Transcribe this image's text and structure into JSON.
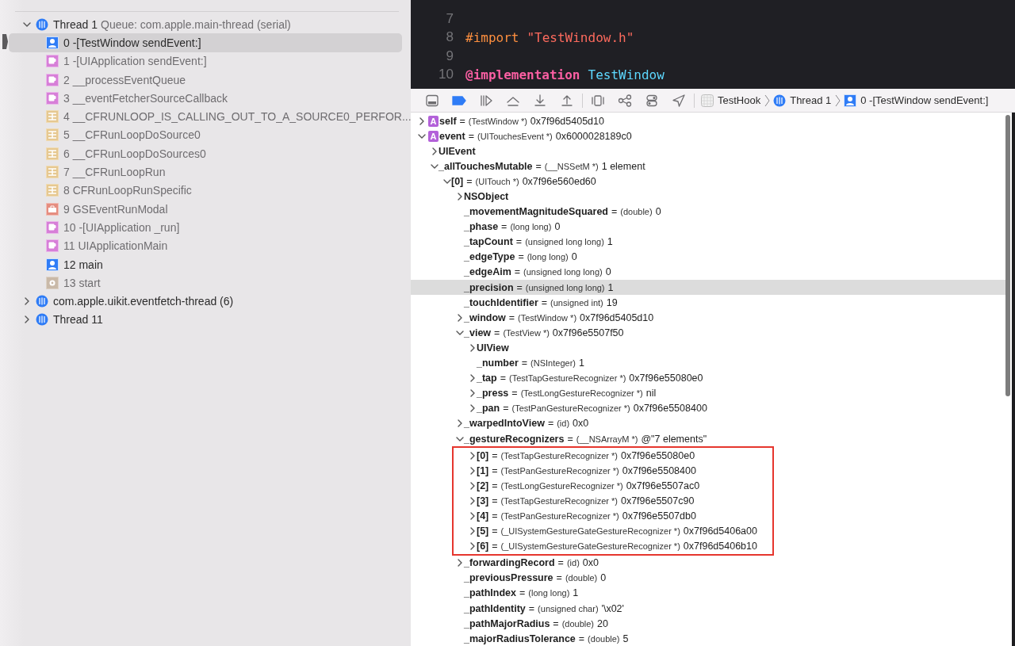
{
  "threads": [
    {
      "name": "Thread 1",
      "queue": "Queue: com.apple.main-thread (serial)",
      "expanded": true,
      "frames": [
        {
          "label": "0 -[TestWindow sendEvent:]",
          "kind": "user",
          "selected": true
        },
        {
          "label": "1 -[UIApplication sendEvent:]",
          "kind": "uikit",
          "selected": false
        },
        {
          "label": "2 __processEventQueue",
          "kind": "uikit",
          "selected": false
        },
        {
          "label": "3 __eventFetcherSourceCallback",
          "kind": "uikit",
          "selected": false
        },
        {
          "label": "4 __CFRUNLOOP_IS_CALLING_OUT_TO_A_SOURCE0_PERFOR...",
          "kind": "corefoundation",
          "selected": false
        },
        {
          "label": "5 __CFRunLoopDoSource0",
          "kind": "corefoundation",
          "selected": false
        },
        {
          "label": "6 __CFRunLoopDoSources0",
          "kind": "corefoundation",
          "selected": false
        },
        {
          "label": "7 __CFRunLoopRun",
          "kind": "corefoundation",
          "selected": false
        },
        {
          "label": "8 CFRunLoopRunSpecific",
          "kind": "corefoundation",
          "selected": false
        },
        {
          "label": "9 GSEventRunModal",
          "kind": "graphics",
          "selected": false
        },
        {
          "label": "10 -[UIApplication _run]",
          "kind": "uikit",
          "selected": false
        },
        {
          "label": "11 UIApplicationMain",
          "kind": "uikit",
          "selected": false
        },
        {
          "label": "12 main",
          "kind": "user",
          "selected": false
        },
        {
          "label": "13 start",
          "kind": "system",
          "selected": false
        }
      ]
    },
    {
      "name": "com.apple.uikit.eventfetch-thread (6)",
      "expanded": false
    },
    {
      "name": "Thread 11",
      "expanded": false
    }
  ],
  "editor": {
    "lines": [
      {
        "number": "7"
      },
      {
        "number": "8",
        "tokens": [
          {
            "kind": "directive",
            "text": "#import"
          },
          {
            "kind": "string",
            "text": "\"TestWindow.h\""
          }
        ]
      },
      {
        "number": "9"
      },
      {
        "number": "10",
        "tokens": [
          {
            "kind": "keyword",
            "text": "@implementation"
          },
          {
            "kind": "type",
            "text": "TestWindow"
          }
        ]
      }
    ]
  },
  "debug_bar": {
    "breakpoints_on": true,
    "breadcrumbs": [
      {
        "kind": "app",
        "label": "TestHook"
      },
      {
        "kind": "thread",
        "label": "Thread 1"
      },
      {
        "kind": "frame",
        "label": "0 -[TestWindow sendEvent:]"
      }
    ]
  },
  "variables": [
    {
      "badge": "A",
      "name": "self",
      "sep": "=",
      "type": "(TestWindow *)",
      "value": "0x7f96d5405d10",
      "expanded": false,
      "selected": false
    },
    {
      "badge": "A",
      "name": "event",
      "sep": "=",
      "type": "(UITouchesEvent *)",
      "value": "0x6000028189c0",
      "expanded": true,
      "selected": false,
      "children": [
        {
          "name": "UIEvent",
          "expanded": false,
          "selected": false
        },
        {
          "name": "_allTouchesMutable",
          "sep": "=",
          "type": "(__NSSetM *)",
          "value": "1 element",
          "expanded": true,
          "selected": false,
          "children": [
            {
              "name": "[0]",
              "sep": "=",
              "type": "(UITouch *)",
              "value": "0x7f96e560ed60",
              "expanded": true,
              "selected": false,
              "children": [
                {
                  "name": "NSObject",
                  "expanded": false,
                  "selected": false
                },
                {
                  "name": "_movementMagnitudeSquared",
                  "sep": "=",
                  "type": "(double)",
                  "value": "0",
                  "selected": false
                },
                {
                  "name": "_phase",
                  "sep": "=",
                  "type": "(long long)",
                  "value": "0",
                  "selected": false
                },
                {
                  "name": "_tapCount",
                  "sep": "=",
                  "type": "(unsigned long long)",
                  "value": "1",
                  "selected": false
                },
                {
                  "name": "_edgeType",
                  "sep": "=",
                  "type": "(long long)",
                  "value": "0",
                  "selected": false
                },
                {
                  "name": "_edgeAim",
                  "sep": "=",
                  "type": "(unsigned long long)",
                  "value": "0",
                  "selected": false
                },
                {
                  "name": "_precision",
                  "sep": "=",
                  "type": "(unsigned long long)",
                  "value": "1",
                  "selected": true
                },
                {
                  "name": "_touchIdentifier",
                  "sep": "=",
                  "type": "(unsigned int)",
                  "value": "19",
                  "selected": false
                },
                {
                  "name": "_window",
                  "sep": "=",
                  "type": "(TestWindow *)",
                  "value": "0x7f96d5405d10",
                  "expanded": false,
                  "selected": false
                },
                {
                  "name": "_view",
                  "sep": "=",
                  "type": "(TestView *)",
                  "value": "0x7f96e5507f50",
                  "expanded": true,
                  "selected": false,
                  "children": [
                    {
                      "name": "UIView",
                      "expanded": false,
                      "selected": false
                    },
                    {
                      "name": "_number",
                      "sep": "=",
                      "type": "(NSInteger)",
                      "value": "1",
                      "selected": false
                    },
                    {
                      "name": "_tap",
                      "sep": "=",
                      "type": "(TestTapGestureRecognizer *)",
                      "value": "0x7f96e55080e0",
                      "expanded": false,
                      "selected": false
                    },
                    {
                      "name": "_press",
                      "sep": "=",
                      "type": "(TestLongGestureRecognizer *)",
                      "value": "nil",
                      "expanded": false,
                      "selected": false
                    },
                    {
                      "name": "_pan",
                      "sep": "=",
                      "type": "(TestPanGestureRecognizer *)",
                      "value": "0x7f96e5508400",
                      "expanded": false,
                      "selected": false
                    }
                  ]
                },
                {
                  "name": "_warpedIntoView",
                  "sep": "=",
                  "type": "(id)",
                  "value": "0x0",
                  "expanded": false,
                  "selected": false
                },
                {
                  "name": "_gestureRecognizers",
                  "sep": "=",
                  "type": "(__NSArrayM *)",
                  "value": "@\"7 elements\"",
                  "expanded": true,
                  "selected": false,
                  "boxed": true,
                  "children": [
                    {
                      "name": "[0]",
                      "sep": "=",
                      "type": "(TestTapGestureRecognizer *)",
                      "value": "0x7f96e55080e0",
                      "expanded": false,
                      "selected": false
                    },
                    {
                      "name": "[1]",
                      "sep": "=",
                      "type": "(TestPanGestureRecognizer *)",
                      "value": "0x7f96e5508400",
                      "expanded": false,
                      "selected": false
                    },
                    {
                      "name": "[2]",
                      "sep": "=",
                      "type": "(TestLongGestureRecognizer *)",
                      "value": "0x7f96e5507ac0",
                      "expanded": false,
                      "selected": false
                    },
                    {
                      "name": "[3]",
                      "sep": "=",
                      "type": "(TestTapGestureRecognizer *)",
                      "value": "0x7f96e5507c90",
                      "expanded": false,
                      "selected": false
                    },
                    {
                      "name": "[4]",
                      "sep": "=",
                      "type": "(TestPanGestureRecognizer *)",
                      "value": "0x7f96e5507db0",
                      "expanded": false,
                      "selected": false
                    },
                    {
                      "name": "[5]",
                      "sep": "=",
                      "type": "(_UISystemGestureGateGestureRecognizer *)",
                      "value": "0x7f96d5406a00",
                      "expanded": false,
                      "selected": false
                    },
                    {
                      "name": "[6]",
                      "sep": "=",
                      "type": "(_UISystemGestureGateGestureRecognizer *)",
                      "value": "0x7f96d5406b10",
                      "expanded": false,
                      "selected": false
                    }
                  ]
                },
                {
                  "name": "_forwardingRecord",
                  "sep": "=",
                  "type": "(id)",
                  "value": "0x0",
                  "expanded": false,
                  "selected": false
                },
                {
                  "name": "_previousPressure",
                  "sep": "=",
                  "type": "(double)",
                  "value": "0",
                  "selected": false
                },
                {
                  "name": "_pathIndex",
                  "sep": "=",
                  "type": "(long long)",
                  "value": "1",
                  "selected": false
                },
                {
                  "name": "_pathIdentity",
                  "sep": "=",
                  "type": "(unsigned char)",
                  "value": "'\\x02'",
                  "selected": false
                },
                {
                  "name": "_pathMajorRadius",
                  "sep": "=",
                  "type": "(double)",
                  "value": "20",
                  "selected": false
                },
                {
                  "name": "_majorRadiusTolerance",
                  "sep": "=",
                  "type": "(double)",
                  "value": "5",
                  "selected": false
                }
              ]
            }
          ]
        }
      ]
    }
  ]
}
